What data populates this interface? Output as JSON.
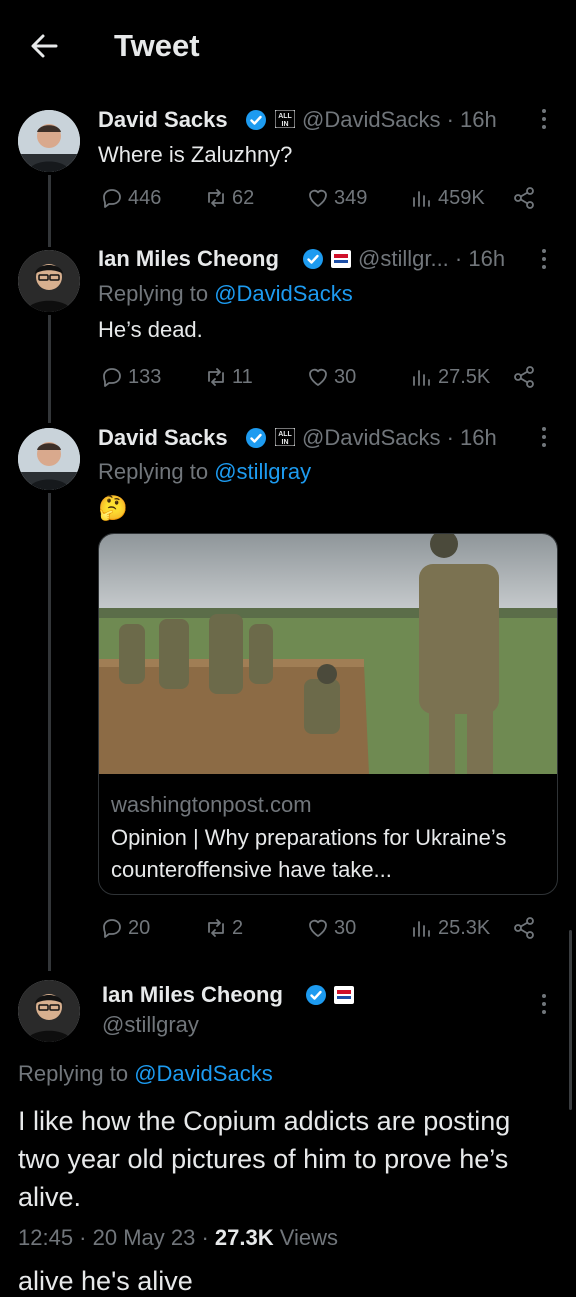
{
  "header": {
    "title": "Tweet"
  },
  "tweets": [
    {
      "name": "David Sacks",
      "handle_time": "@DavidSacks · 16h",
      "affiliation": "ALL IN",
      "text": "Where is Zaluzhny?",
      "replies": "446",
      "retweets": "62",
      "likes": "349",
      "views": "459K"
    },
    {
      "name": "Ian Miles Cheong",
      "handle_time": "@stillgr... · 16h",
      "replying_prefix": "Replying to",
      "replying_to": "@DavidSacks",
      "text": "He’s dead.",
      "replies": "133",
      "retweets": "11",
      "likes": "30",
      "views": "27.5K"
    },
    {
      "name": "David Sacks",
      "handle_time": "@DavidSacks · 16h",
      "affiliation": "ALL IN",
      "replying_prefix": "Replying to",
      "replying_to": "@stillgray",
      "emoji": "🤔",
      "card_domain": "washingtonpost.com",
      "card_title": "Opinion | Why preparations for Ukraine’s counteroffensive have take...",
      "replies": "20",
      "retweets": "2",
      "likes": "30",
      "views": "25.3K"
    }
  ],
  "main_tweet": {
    "name": "Ian Miles Cheong",
    "handle": "@stillgray",
    "replying_prefix": "Replying to",
    "replying_to": "@DavidSacks",
    "text": "I like how the Copium addicts are posting two year old pictures of him to prove he’s alive.",
    "time_date": "12:45 · 20 May 23 · ",
    "views_count": "27.3K",
    "views_label": "Views",
    "cutoff_text": "alive he's alive"
  },
  "colors": {
    "background": "#000000",
    "text": "#e7e9ea",
    "muted": "#71767b",
    "link": "#1d9bf0",
    "verified": "#1d9bf0"
  }
}
